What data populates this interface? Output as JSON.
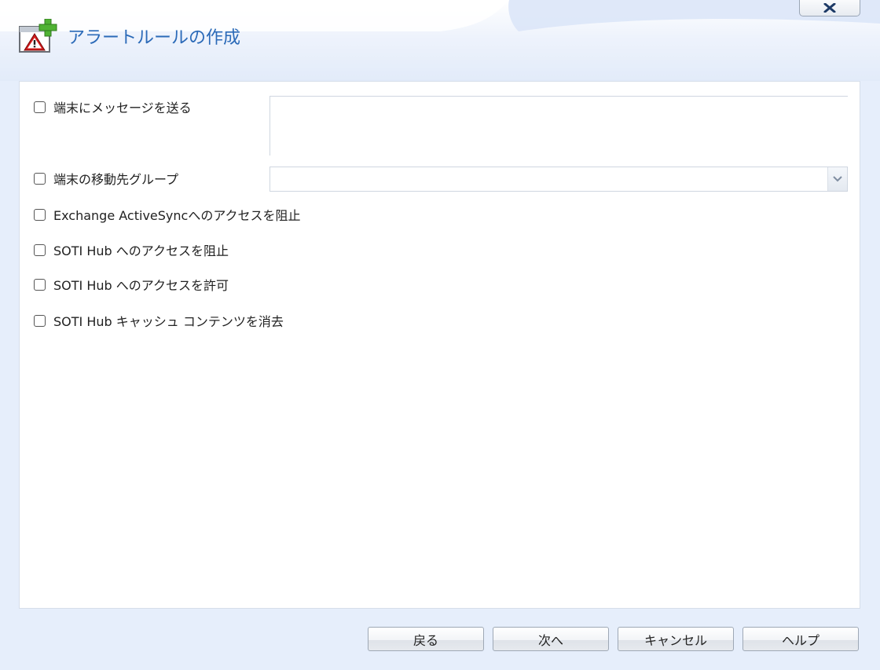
{
  "dialog": {
    "title": "アラートルールの作成",
    "close_label": "x"
  },
  "options": [
    {
      "label": "端末にメッセージを送る",
      "checked": false
    },
    {
      "label": "端末の移動先グループ",
      "checked": false
    },
    {
      "label": "Exchange ActiveSyncへのアクセスを阻止",
      "checked": false
    },
    {
      "label": "SOTI Hub へのアクセスを阻止",
      "checked": false
    },
    {
      "label": "SOTI Hub へのアクセスを許可",
      "checked": false
    },
    {
      "label": "SOTI Hub キャッシュ コンテンツを消去",
      "checked": false
    }
  ],
  "message_field": {
    "value": ""
  },
  "group_select": {
    "selected": ""
  },
  "footer": {
    "back_label": "戻る",
    "next_label": "次へ",
    "cancel_label": "キャンセル",
    "help_label": "ヘルプ"
  },
  "colors": {
    "title": "#2b6ab8",
    "background": "#e6eefb",
    "panel": "#ffffff"
  },
  "icons": {
    "title_icon": "alert-add-icon",
    "close": "close-icon",
    "dropdown": "chevron-down-icon"
  }
}
